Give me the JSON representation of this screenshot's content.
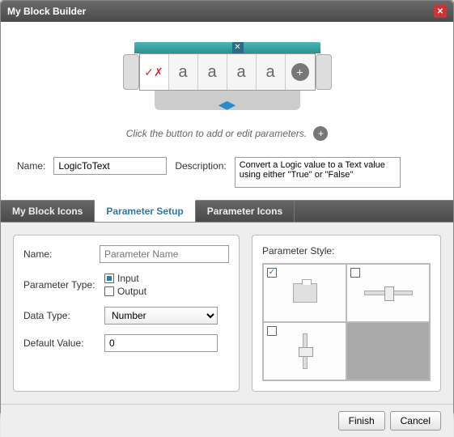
{
  "window": {
    "title": "My Block Builder"
  },
  "preview": {
    "segments": [
      "a",
      "a",
      "a",
      "a"
    ],
    "hint": "Click the button to add or edit parameters."
  },
  "form": {
    "name_label": "Name:",
    "name_value": "LogicToText",
    "desc_label": "Description:",
    "desc_value": "Convert a Logic value to a Text value using either \"True\" or \"False\""
  },
  "tabs": [
    {
      "label": "My Block Icons",
      "active": false
    },
    {
      "label": "Parameter Setup",
      "active": true
    },
    {
      "label": "Parameter Icons",
      "active": false
    }
  ],
  "param": {
    "name_label": "Name:",
    "name_placeholder": "Parameter Name",
    "type_label": "Parameter Type:",
    "type_options": {
      "input": "Input",
      "output": "Output"
    },
    "type_selected": "input",
    "datatype_label": "Data Type:",
    "datatype_value": "Number",
    "default_label": "Default Value:",
    "default_value": "0",
    "style_label": "Parameter Style:",
    "style_selected": 0
  },
  "footer": {
    "finish": "Finish",
    "cancel": "Cancel"
  }
}
